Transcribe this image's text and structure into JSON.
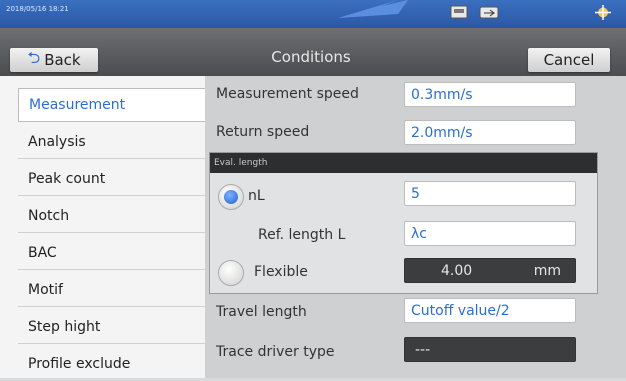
{
  "status": {
    "timestamp": "2018/05/16 18:21",
    "printer_icon": "printer-icon",
    "usb_icon": "usb-icon",
    "move_icon": "move-icon"
  },
  "header": {
    "back_label": "Back",
    "title": "Conditions",
    "cancel_label": "Cancel"
  },
  "sidebar": {
    "items": [
      {
        "label": "Measurement",
        "selected": true
      },
      {
        "label": "Analysis"
      },
      {
        "label": "Peak count"
      },
      {
        "label": "Notch"
      },
      {
        "label": "BAC"
      },
      {
        "label": "Motif"
      },
      {
        "label": "Step hight"
      },
      {
        "label": "Profile exclude"
      }
    ]
  },
  "settings": {
    "measurement_speed": {
      "label": "Measurement speed",
      "value": "0.3mm/s"
    },
    "return_speed": {
      "label": "Return speed",
      "value": "2.0mm/s"
    },
    "eval_length": {
      "header": "Eval. length",
      "nl": {
        "label": "nL",
        "value": "5",
        "selected": true
      },
      "ref_length": {
        "label": "Ref. length L",
        "value": "λc"
      },
      "flexible": {
        "label": "Flexible",
        "value": "4.00",
        "unit": "mm",
        "selected": false
      }
    },
    "travel_length": {
      "label": "Travel length",
      "value": "Cutoff value/2"
    },
    "trace_driver": {
      "label": "Trace driver type",
      "value": "---"
    }
  },
  "colors": {
    "accent": "#2a6fd0",
    "header": "#4f5154",
    "statusbar": "#2f5fae"
  }
}
